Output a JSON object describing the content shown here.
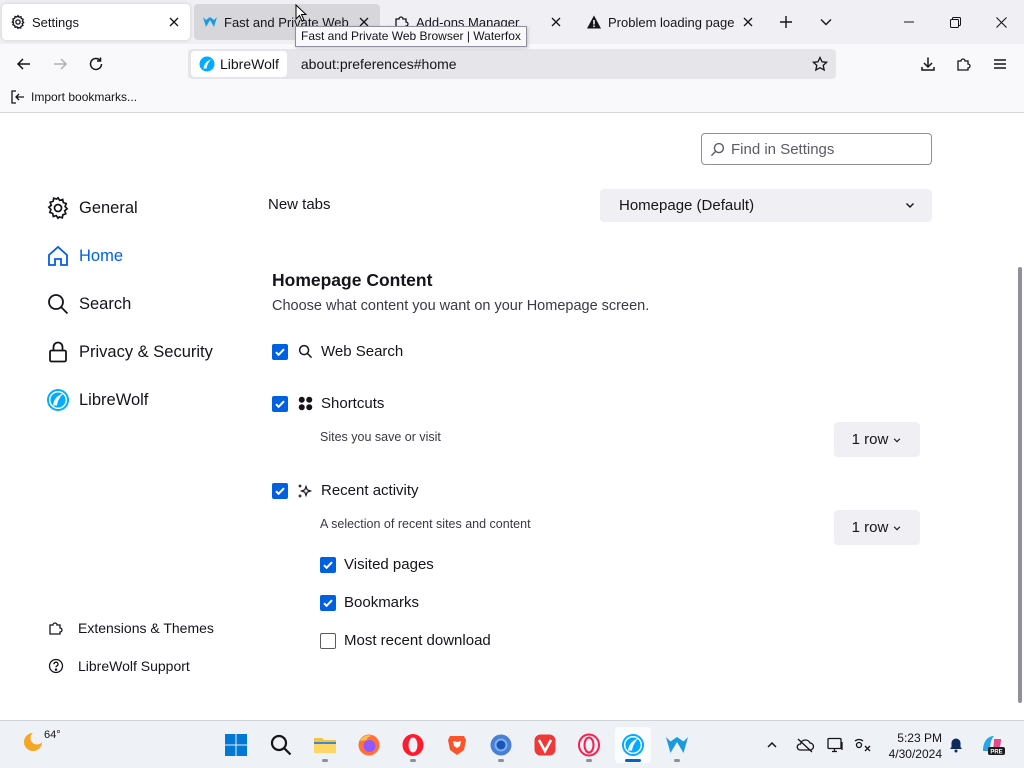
{
  "tabs": [
    {
      "title": "Settings",
      "state": "active",
      "icon": "gear-icon"
    },
    {
      "title": "Fast and Private Web Browser | Waterfox",
      "display": "Fast and Private Web Br",
      "state": "hover",
      "icon": "waterfox-icon"
    },
    {
      "title": "Add-ons Manager",
      "state": "normal",
      "icon": "puzzle-icon"
    },
    {
      "title": "Problem loading page",
      "state": "normal",
      "icon": "warning-icon"
    }
  ],
  "tooltip": "Fast and Private Web Browser | Waterfox",
  "urlbar": {
    "identity": "LibreWolf",
    "url": "about:preferences#home"
  },
  "bookmarks": {
    "import": "Import bookmarks..."
  },
  "search": {
    "placeholder": "Find in Settings"
  },
  "sidebar": {
    "categories": [
      {
        "label": "General",
        "icon": "gear-icon"
      },
      {
        "label": "Home",
        "icon": "home-icon",
        "selected": true
      },
      {
        "label": "Search",
        "icon": "search-icon"
      },
      {
        "label": "Privacy & Security",
        "icon": "lock-icon"
      },
      {
        "label": "LibreWolf",
        "icon": "librewolf-icon"
      }
    ],
    "footer": [
      {
        "label": "Extensions & Themes",
        "icon": "puzzle-icon"
      },
      {
        "label": "LibreWolf Support",
        "icon": "help-icon"
      }
    ]
  },
  "main": {
    "new_tabs_label": "New tabs",
    "new_tabs_value": "Homepage (Default)",
    "section_title": "Homepage Content",
    "section_desc": "Choose what content you want on your Homepage screen.",
    "web_search": {
      "label": "Web Search",
      "checked": true
    },
    "shortcuts": {
      "label": "Shortcuts",
      "checked": true,
      "desc": "Sites you save or visit",
      "rows": "1 row"
    },
    "recent_activity": {
      "label": "Recent activity",
      "checked": true,
      "desc": "A selection of recent sites and content",
      "rows": "1 row"
    },
    "visited_pages": {
      "label": "Visited pages",
      "checked": true
    },
    "bookmarks": {
      "label": "Bookmarks",
      "checked": true
    },
    "recent_download": {
      "label": "Most recent download",
      "checked": false
    }
  },
  "taskbar": {
    "weather_temp": "64°",
    "time": "5:23 PM",
    "date": "4/30/2024",
    "apps": [
      "start",
      "search",
      "file-explorer",
      "firefox",
      "opera",
      "brave",
      "chrome",
      "vivaldi",
      "opera-gx",
      "librewolf",
      "waterfox"
    ]
  },
  "colors": {
    "accent": "#0061e0",
    "tab_strip": "#f0f0f4",
    "taskbar": "#eef1f6"
  }
}
